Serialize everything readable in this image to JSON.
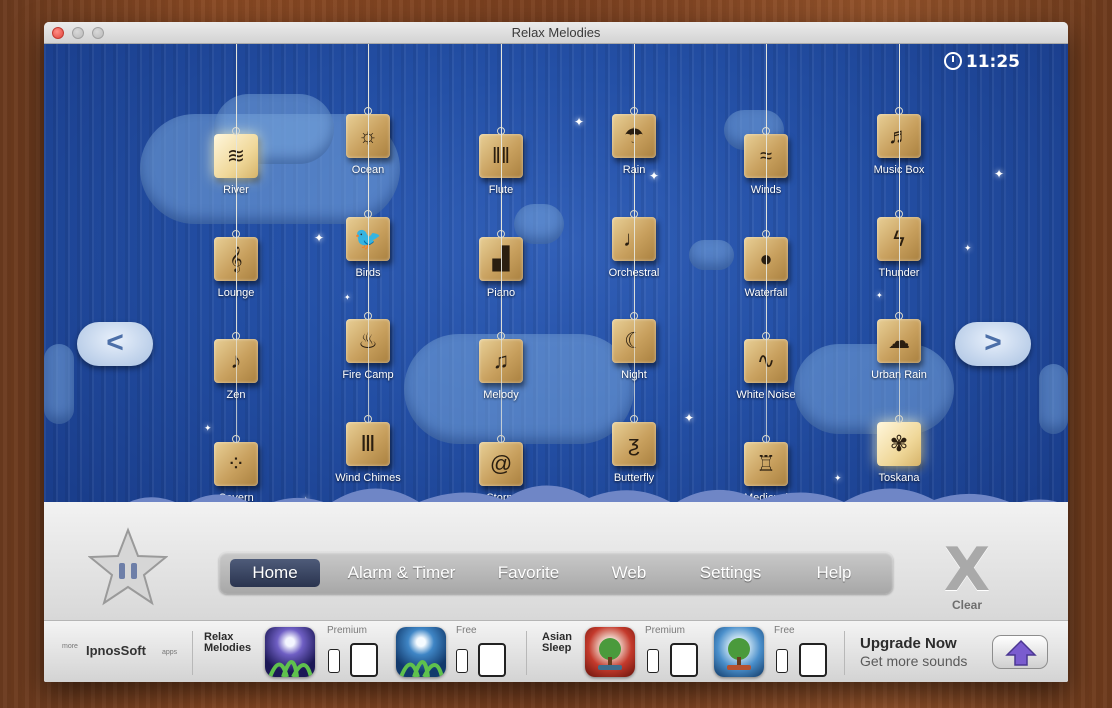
{
  "window": {
    "title": "Relax Melodies"
  },
  "clock": {
    "time": "11:25"
  },
  "sounds": [
    {
      "label": "River",
      "icon": "waves-icon",
      "glyph": "≋",
      "active": true
    },
    {
      "label": "Lounge",
      "icon": "treble-clef-icon",
      "glyph": "𝄞"
    },
    {
      "label": "Zen",
      "icon": "music-note-icon",
      "glyph": "♪"
    },
    {
      "label": "Cavern",
      "icon": "water-drops-icon",
      "glyph": "⁘"
    },
    {
      "label": "Ocean",
      "icon": "sun-over-sea-icon",
      "glyph": "☼"
    },
    {
      "label": "Birds",
      "icon": "bird-icon",
      "glyph": "🐦"
    },
    {
      "label": "Fire Camp",
      "icon": "fire-icon",
      "glyph": "♨"
    },
    {
      "label": "Wind Chimes",
      "icon": "wind-chimes-icon",
      "glyph": "Ⅲ"
    },
    {
      "label": "Flute",
      "icon": "pan-flute-icon",
      "glyph": "‖‖"
    },
    {
      "label": "Piano",
      "icon": "piano-icon",
      "glyph": "▟"
    },
    {
      "label": "Melody",
      "icon": "eighth-notes-icon",
      "glyph": "♫"
    },
    {
      "label": "Storm",
      "icon": "spiral-icon",
      "glyph": "@"
    },
    {
      "label": "Rain",
      "icon": "rain-cloud-icon",
      "glyph": "☂"
    },
    {
      "label": "Orchestral",
      "icon": "quarter-note-icon",
      "glyph": "♩"
    },
    {
      "label": "Night",
      "icon": "moon-icon",
      "glyph": "☾"
    },
    {
      "label": "Butterfly",
      "icon": "butterfly-icon",
      "glyph": "ƺ"
    },
    {
      "label": "Winds",
      "icon": "wind-swirl-icon",
      "glyph": "≈"
    },
    {
      "label": "Waterfall",
      "icon": "water-drop-icon",
      "glyph": "●"
    },
    {
      "label": "White Noise",
      "icon": "waveform-icon",
      "glyph": "∿"
    },
    {
      "label": "Medieval",
      "icon": "bell-icon",
      "glyph": "♖"
    },
    {
      "label": "Music Box",
      "icon": "music-box-icon",
      "glyph": "♬"
    },
    {
      "label": "Thunder",
      "icon": "lightning-icon",
      "glyph": "ϟ"
    },
    {
      "label": "Urban Rain",
      "icon": "car-rain-icon",
      "glyph": "☁"
    },
    {
      "label": "Toskana",
      "icon": "cricket-icon",
      "glyph": "✾",
      "active": true
    }
  ],
  "nav": {
    "prev": "<",
    "next": ">",
    "pause_icon": "pause-icon",
    "tabs": [
      "Home",
      "Alarm & Timer",
      "Favorite",
      "Web",
      "Settings",
      "Help"
    ],
    "selected": "Home",
    "clear_label": "Clear",
    "clear_glyph": "X"
  },
  "promo": {
    "more_label": "more",
    "brand": "IpnosSoft",
    "apps_label": "apps",
    "relax_name": "Relax\nMelodies",
    "relax_line1": "Relax",
    "relax_line2": "Melodies",
    "asian_line1": "Asian",
    "asian_line2": "Sleep",
    "premium": "Premium",
    "free": "Free",
    "upgrade_title": "Upgrade Now",
    "upgrade_sub": "Get more sounds"
  },
  "colors": {
    "accent": "#2a344f",
    "sky": "#2450a6",
    "tile": "#c8a05e"
  }
}
